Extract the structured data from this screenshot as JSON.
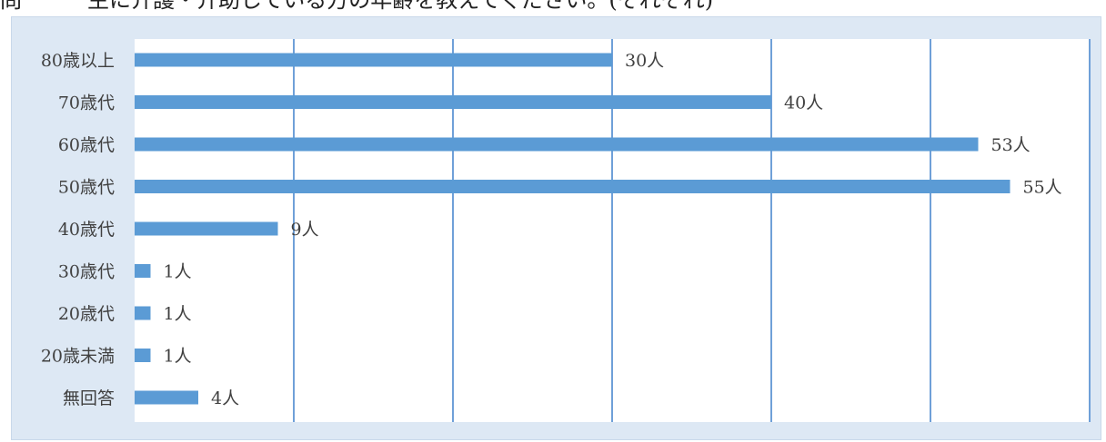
{
  "header": {
    "caption": "問　　　主に介護・介助している方の年齢を教えてください。(それぞれ)"
  },
  "chart_data": {
    "type": "bar",
    "orientation": "horizontal",
    "categories": [
      "80歳以上",
      "70歳代",
      "60歳代",
      "50歳代",
      "40歳代",
      "30歳代",
      "20歳代",
      "20歳未満",
      "無回答"
    ],
    "values": [
      30,
      40,
      53,
      55,
      9,
      1,
      1,
      1,
      4
    ],
    "data_labels": [
      "30人",
      "40人",
      "53人",
      "55人",
      "9人",
      "1人",
      "1人",
      "1人",
      "4人"
    ],
    "xlim": [
      0,
      60
    ],
    "grid": true,
    "bar_color": "#5b9bd5",
    "grid_color": "#6fa0d8",
    "panel_color": "#dde8f4",
    "plot_color": "#ffffff"
  }
}
